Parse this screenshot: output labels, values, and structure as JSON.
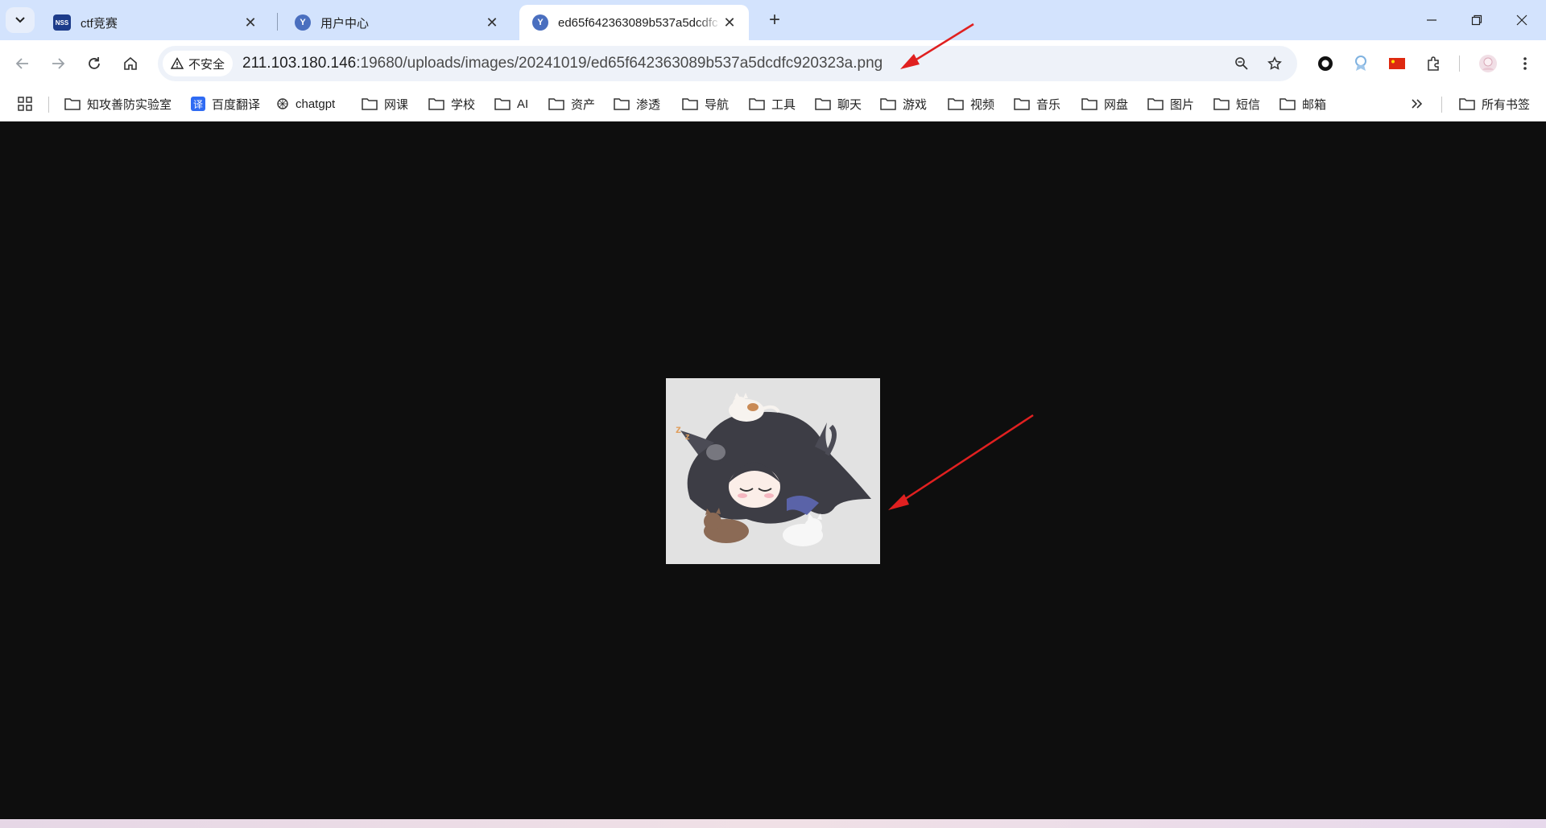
{
  "tabs": [
    {
      "title": "ctf竞赛",
      "favicon": "nssctf-logo-icon",
      "active": false
    },
    {
      "title": "用户中心",
      "favicon": "y-logo-icon",
      "active": false
    },
    {
      "title": "ed65f642363089b537a5dcdfc",
      "favicon": "y-logo-icon",
      "active": true
    }
  ],
  "omnibox": {
    "security_label": "不安全",
    "url_host": "211.103.180.146",
    "url_rest": ":19680/uploads/images/20241019/ed65f642363089b537a5dcdfc920323a.png"
  },
  "bookmarks": [
    {
      "label": "知攻善防实验室",
      "icon": "folder-icon"
    },
    {
      "label": "百度翻译",
      "icon": "translate-icon"
    },
    {
      "label": "chatgpt",
      "icon": "openai-icon"
    },
    {
      "label": "网课",
      "icon": "folder-icon"
    },
    {
      "label": "学校",
      "icon": "folder-icon"
    },
    {
      "label": "AI",
      "icon": "folder-icon"
    },
    {
      "label": "资产",
      "icon": "folder-icon"
    },
    {
      "label": "渗透",
      "icon": "folder-icon"
    },
    {
      "label": "导航",
      "icon": "folder-icon"
    },
    {
      "label": "工具",
      "icon": "folder-icon"
    },
    {
      "label": "聊天",
      "icon": "folder-icon"
    },
    {
      "label": "游戏",
      "icon": "folder-icon"
    },
    {
      "label": "视频",
      "icon": "folder-icon"
    },
    {
      "label": "音乐",
      "icon": "folder-icon"
    },
    {
      "label": "网盘",
      "icon": "folder-icon"
    },
    {
      "label": "图片",
      "icon": "folder-icon"
    },
    {
      "label": "短信",
      "icon": "folder-icon"
    },
    {
      "label": "邮箱",
      "icon": "folder-icon"
    }
  ],
  "all_bookmarks_label": "所有书签",
  "colors": {
    "tabstrip": "#d3e3fd",
    "page_background": "#0e0e0e",
    "annotation_arrow": "#e02020"
  },
  "content": {
    "image_description_icon": "anime-catgirl-sleeping-image"
  }
}
